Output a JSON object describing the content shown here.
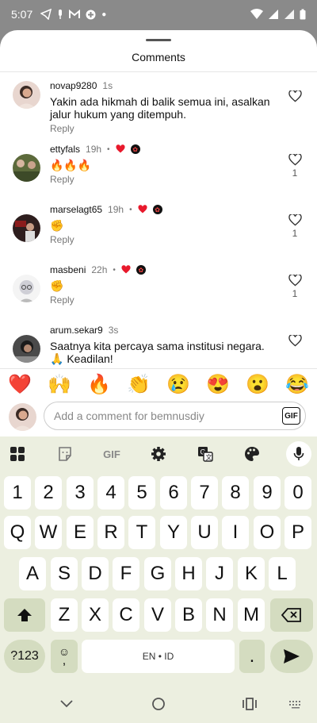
{
  "status": {
    "time": "5:07"
  },
  "sheet": {
    "title": "Comments"
  },
  "comments": [
    {
      "user": "novap9280",
      "time": "1s",
      "text": "Yakin ada hikmah di balik semua ini, asalkan jalur hukum yang ditempuh.",
      "reply": "Reply",
      "likes": "",
      "reactions": false
    },
    {
      "user": "ettyfals",
      "time": "19h",
      "text": "🔥🔥🔥",
      "reply": "Reply",
      "likes": "1",
      "reactions": true
    },
    {
      "user": "marselagt65",
      "time": "19h",
      "text": "✊",
      "reply": "Reply",
      "likes": "1",
      "reactions": true
    },
    {
      "user": "masbeni",
      "time": "22h",
      "text": "✊",
      "reply": "Reply",
      "likes": "1",
      "reactions": true
    },
    {
      "user": "arum.sekar9",
      "time": "3s",
      "text": "Saatnya kita percaya sama institusi negara. 🙏 Keadilan!",
      "reply": "",
      "likes": "",
      "reactions": false
    }
  ],
  "emoji_bar": [
    "❤️",
    "🙌",
    "🔥",
    "👏",
    "😢",
    "😍",
    "😮",
    "😂"
  ],
  "composer": {
    "placeholder": "Add a comment for bemnusdiy",
    "value": "",
    "gif_label": "GIF"
  },
  "keyboard": {
    "toolbar": {
      "gif_label": "GIF"
    },
    "numbers": [
      "1",
      "2",
      "3",
      "4",
      "5",
      "6",
      "7",
      "8",
      "9",
      "0"
    ],
    "row1": [
      "Q",
      "W",
      "E",
      "R",
      "T",
      "Y",
      "U",
      "I",
      "O",
      "P"
    ],
    "row2": [
      "A",
      "S",
      "D",
      "F",
      "G",
      "H",
      "J",
      "K",
      "L"
    ],
    "row3": [
      "Z",
      "X",
      "C",
      "V",
      "B",
      "N",
      "M"
    ],
    "symbols_label": "?123",
    "emoji_key": "☺",
    "comma": ",",
    "space_label": "EN • ID",
    "period": "."
  },
  "colors": {
    "heart": "#e8192c",
    "keyboard_bg": "#ecefe0",
    "dark_key": "#d4dcc0"
  }
}
